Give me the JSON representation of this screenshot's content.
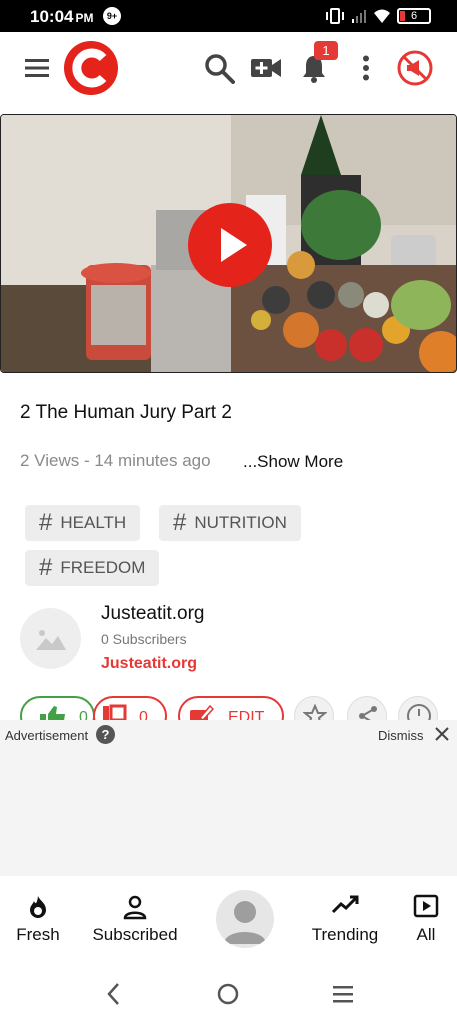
{
  "status_bar": {
    "time": "10:04",
    "ampm": "PM",
    "notification_count": "9+",
    "battery": "6"
  },
  "header": {
    "bell_badge": "1"
  },
  "video": {
    "title": "2 The Human Jury Part 2",
    "meta": "2 Views - 14 minutes ago",
    "show_more": "...Show More"
  },
  "tags": [
    {
      "label": "HEALTH"
    },
    {
      "label": "NUTRITION"
    },
    {
      "label": "FREEDOM"
    }
  ],
  "channel": {
    "name": "Justeatit.org",
    "subscribers": "0 Subscribers",
    "link_label": "Justeatit.org"
  },
  "actions": {
    "likes": "0",
    "dislikes": "0",
    "edit": "EDIT"
  },
  "ad": {
    "label": "Advertisement",
    "help": "?",
    "dismiss": "Dismiss"
  },
  "bottom_nav": {
    "fresh": "Fresh",
    "subscribed": "Subscribed",
    "trending": "Trending",
    "all": "All"
  },
  "colors": {
    "accent": "#e53935",
    "like_green": "#43a047"
  }
}
